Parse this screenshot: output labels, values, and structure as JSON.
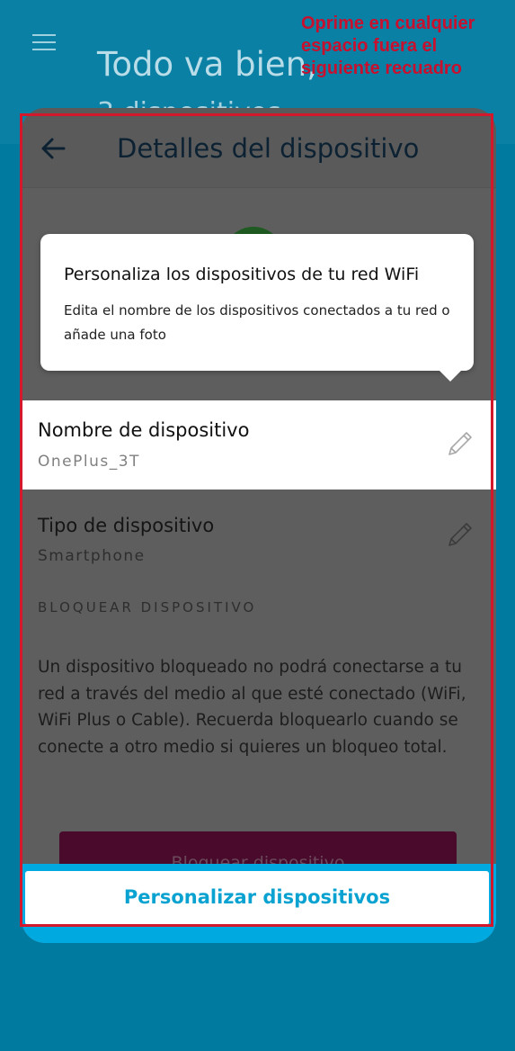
{
  "background": {
    "greeting": "Todo va bien,",
    "greeting_sub": "3 dispositivos"
  },
  "instruction": {
    "text": "Oprime en cualquier\nespacio fuera el\nsiguiente recuadro",
    "color": "#c8102e"
  },
  "topbar": {
    "title": "Detalles del dispositivo"
  },
  "tooltip": {
    "title": "Personaliza los dispositivos de tu red WiFi",
    "body": "Edita el nombre de los dispositivos conectados a tu red o añade una foto"
  },
  "device_name": {
    "label": "Nombre de dispositivo",
    "value": "OnePlus_3T"
  },
  "device_type": {
    "label": "Tipo de dispositivo",
    "value": "Smartphone"
  },
  "block_section": {
    "heading": "BLOQUEAR DISPOSITIVO",
    "description": "Un dispositivo bloqueado no podrá conectarse a tu red a través del medio al que esté conectado (WiFi, WiFi Plus o Cable). Recuerda bloquearlo cuando se conecte a otro medio si quieres un bloqueo total.",
    "button_label": "Bloquear dispositivo"
  },
  "primary_action": {
    "label": "Personalizar dispositivos",
    "color": "#0aa2d0"
  },
  "colors": {
    "background": "#007a9f",
    "overlay": "#5e5e5e",
    "highlight_frame": "#d3182b",
    "accent_strip": "#00a9e0"
  },
  "icons": {
    "menu": "hamburger-menu-icon",
    "back": "back-arrow-icon",
    "edit": "pencil-icon"
  }
}
